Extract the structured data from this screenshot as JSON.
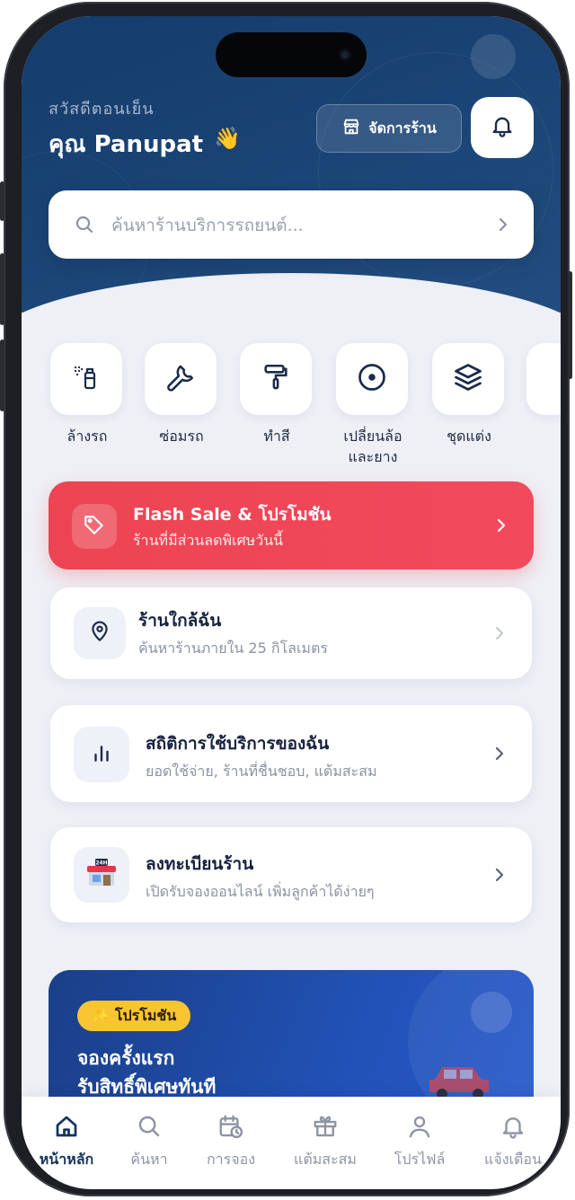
{
  "header": {
    "greeting": "สวัสดีตอนเย็น",
    "user_name": "คุณ Panupat",
    "wave_emoji": "👋",
    "manage_shop_label": "จัดการร้าน"
  },
  "search": {
    "placeholder": "ค้นหาร้านบริการรถยนต์..."
  },
  "categories": [
    {
      "label": "ล้างรถ",
      "icon": "spray-bottle-icon"
    },
    {
      "label": "ซ่อมรถ",
      "icon": "wrench-icon"
    },
    {
      "label": "ทำสี",
      "icon": "paint-roller-icon"
    },
    {
      "label": "เปลี่ยนล้อ\nและยาง",
      "icon": "wheel-icon"
    },
    {
      "label": "ชุดแต่ง",
      "icon": "layers-icon"
    }
  ],
  "flash_sale": {
    "title": "Flash Sale & โปรโมชัน",
    "subtitle": "ร้านที่มีส่วนลดพิเศษวันนี้",
    "icon": "tag-icon"
  },
  "cards": [
    {
      "title": "ร้านใกล้ฉัน",
      "subtitle": "ค้นหาร้านภายใน 25 กิโลเมตร",
      "icon": "location-pin-icon"
    },
    {
      "title": "สถิติการใช้บริการของฉัน",
      "subtitle": "ยอดใช้จ่าย, ร้านที่ชื่นชอบ, แต้มสะสม",
      "icon": "bar-chart-icon"
    },
    {
      "title": "ลงทะเบียนร้าน",
      "subtitle": "เปิดรับจองออนไลน์ เพิ่มลูกค้าได้ง่ายๆ",
      "icon": "store-24h-icon"
    }
  ],
  "promo": {
    "badge": "โปรโมชัน",
    "badge_emoji": "✨",
    "headline_1": "จองครั้งแรก",
    "headline_2": "รับสิทธิ์พิเศษทันที"
  },
  "tabs": [
    {
      "label": "หน้าหลัก",
      "icon": "home-icon",
      "active": true
    },
    {
      "label": "ค้นหา",
      "icon": "search-icon",
      "active": false
    },
    {
      "label": "การจอง",
      "icon": "calendar-clock-icon",
      "active": false
    },
    {
      "label": "แต้มสะสม",
      "icon": "gift-icon",
      "active": false
    },
    {
      "label": "โปรไฟล์",
      "icon": "user-icon",
      "active": false
    },
    {
      "label": "แจ้งเตือน",
      "icon": "bell-icon",
      "active": false
    }
  ],
  "colors": {
    "header_navy": "#143c6d",
    "flash_red": "#ec4452",
    "promo_blue": "#2152b7",
    "badge_yellow": "#f7c531",
    "text_dark": "#16223e"
  }
}
